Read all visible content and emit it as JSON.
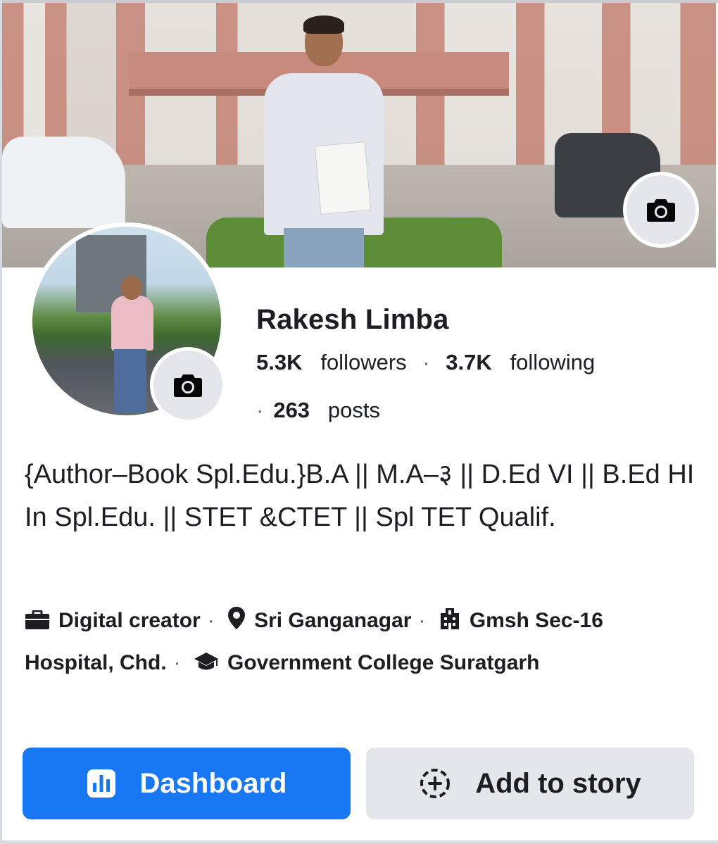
{
  "profile": {
    "name": "Rakesh Limba",
    "followers_count": "5.3K",
    "followers_label": "followers",
    "following_count": "3.7K",
    "following_label": "following",
    "separator": "·",
    "posts_count": "263",
    "posts_label": "posts",
    "bio": "{Author–Book Spl.Edu.}B.A || M.A–३ || D.Ed VI || B.Ed HI In Spl.Edu. || STET &CTET || Spl TET Qualif."
  },
  "details": [
    {
      "icon": "briefcase-icon",
      "text": "Digital creator"
    },
    {
      "icon": "location-pin-icon",
      "text": "Sri Ganganagar"
    },
    {
      "icon": "building-icon",
      "text": "Gmsh Sec-16 Hospital, Chd."
    },
    {
      "icon": "graduation-cap-icon",
      "text": "Government College Suratgarh"
    }
  ],
  "buttons": {
    "dashboard": {
      "label": "Dashboard",
      "icon": "bar-chart-icon"
    },
    "add_story": {
      "label": "Add to story",
      "icon": "add-story-icon"
    }
  },
  "colors": {
    "primary": "#1877f2",
    "secondary": "#e4e6eb",
    "text": "#1c1e21",
    "muted": "#65676b"
  }
}
